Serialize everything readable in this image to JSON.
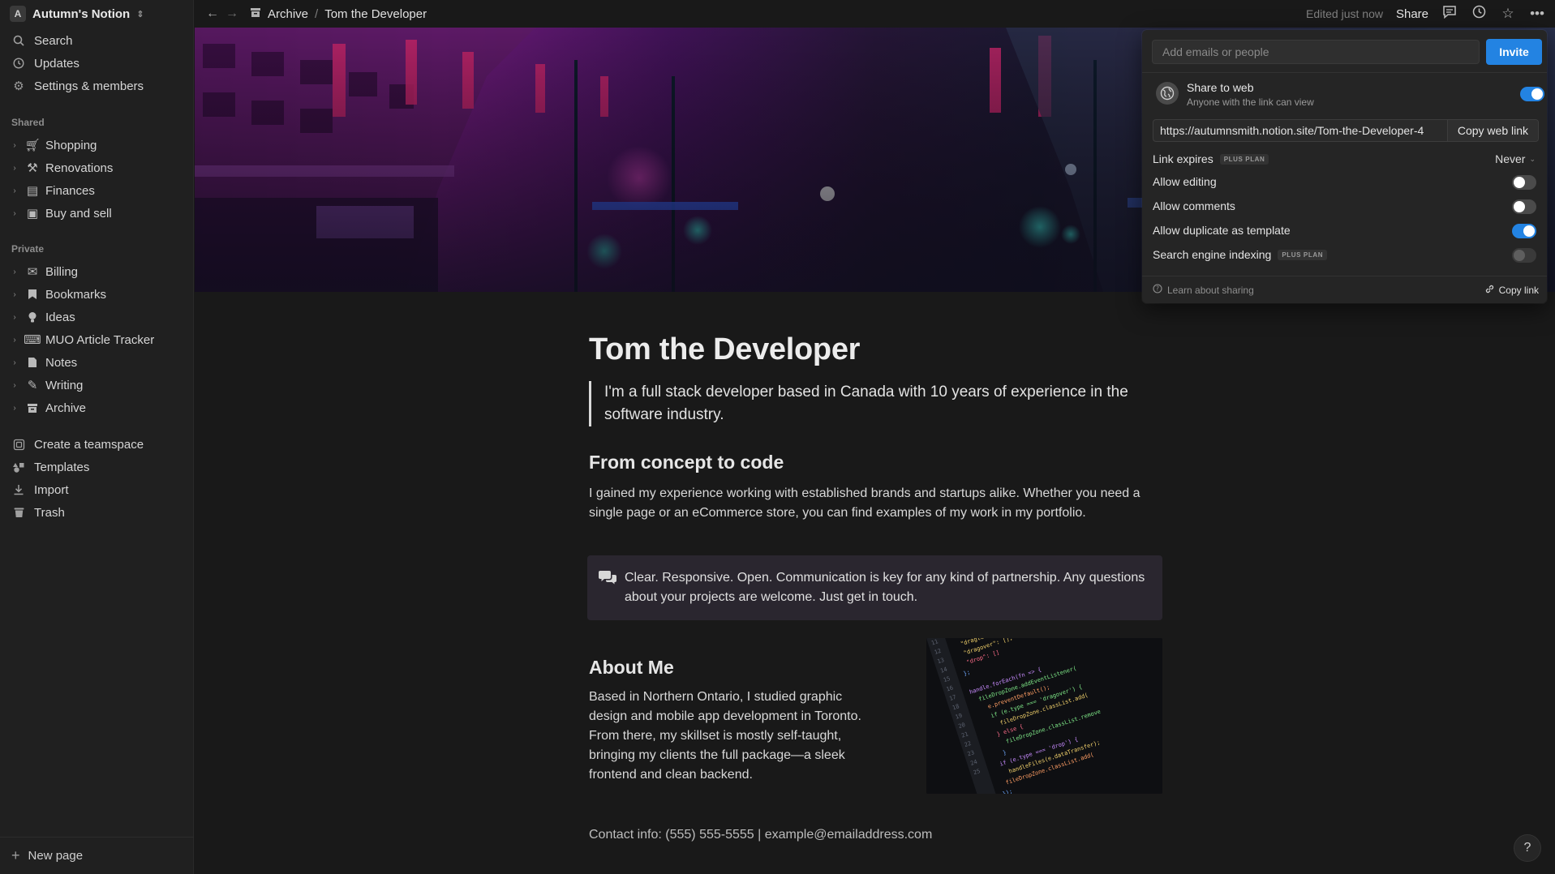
{
  "workspace": {
    "avatar_letter": "A",
    "name": "Autumn's Notion"
  },
  "sidebar": {
    "top_items": [
      {
        "label": "Search",
        "icon": "search-icon"
      },
      {
        "label": "Updates",
        "icon": "clock-icon"
      },
      {
        "label": "Settings & members",
        "icon": "gear-icon"
      }
    ],
    "shared_heading": "Shared",
    "shared_pages": [
      {
        "label": "Shopping",
        "icon": "cart-icon"
      },
      {
        "label": "Renovations",
        "icon": "hammer-icon"
      },
      {
        "label": "Finances",
        "icon": "table-icon"
      },
      {
        "label": "Buy and sell",
        "icon": "cash-icon"
      }
    ],
    "private_heading": "Private",
    "private_pages": [
      {
        "label": "Billing",
        "icon": "mail-icon"
      },
      {
        "label": "Bookmarks",
        "icon": "bookmark-icon"
      },
      {
        "label": "Ideas",
        "icon": "lightbulb-icon"
      },
      {
        "label": "MUO Article Tracker",
        "icon": "keyboard-icon"
      },
      {
        "label": "Notes",
        "icon": "document-icon"
      },
      {
        "label": "Writing",
        "icon": "pencil-icon"
      },
      {
        "label": "Archive",
        "icon": "archive-icon"
      }
    ],
    "bottom_items": [
      {
        "label": "Create a teamspace",
        "icon": "teamspace-icon"
      },
      {
        "label": "Templates",
        "icon": "shapes-icon"
      },
      {
        "label": "Import",
        "icon": "download-icon"
      },
      {
        "label": "Trash",
        "icon": "trash-icon"
      }
    ],
    "new_page_label": "New page"
  },
  "topbar": {
    "breadcrumb": [
      "Archive",
      "Tom the Developer"
    ],
    "edited_status": "Edited just now",
    "share_label": "Share"
  },
  "page": {
    "title": "Tom the Developer",
    "quote": "I'm a full stack developer based in Canada with 10 years of experience in the software industry.",
    "section1_heading": "From concept to code",
    "section1_text": "I gained my experience working with established brands and startups alike. Whether you need a single page or an eCommerce store, you can find examples of my work in my portfolio.",
    "callout_text": "Clear. Responsive. Open. Communication is key for any kind of partnership. Any questions about your projects are welcome. Just get in touch.",
    "about_heading": "About Me",
    "about_text": "Based in Northern Ontario, I studied graphic design and mobile app development in Toronto. From there, my skillset is mostly self-taught, bringing my clients the full package—a sleek frontend and clean backend.",
    "contact": "Contact info: (555) 555-5555  | example@emailaddress.com"
  },
  "share_panel": {
    "invite_placeholder": "Add emails or people",
    "invite_label": "Invite",
    "web_title": "Share to web",
    "web_subtitle": "Anyone with the link can view",
    "web_enabled": true,
    "link_url": "https://autumnsmith.notion.site/Tom-the-Developer-4",
    "copy_web_link_label": "Copy web link",
    "link_expires_label": "Link expires",
    "plan_badge": "PLUS PLAN",
    "link_expires_value": "Never",
    "options": [
      {
        "label": "Allow editing",
        "enabled": false
      },
      {
        "label": "Allow comments",
        "enabled": false
      },
      {
        "label": "Allow duplicate as template",
        "enabled": true
      },
      {
        "label": "Search engine indexing",
        "enabled": false,
        "plan_badge": "PLUS PLAN"
      }
    ],
    "learn_label": "Learn about sharing",
    "copy_link_label": "Copy link"
  },
  "help_label": "?",
  "colors": {
    "accent": "#2383e2",
    "background": "#191919",
    "sidebar": "#202020",
    "callout": "#2a262f"
  }
}
